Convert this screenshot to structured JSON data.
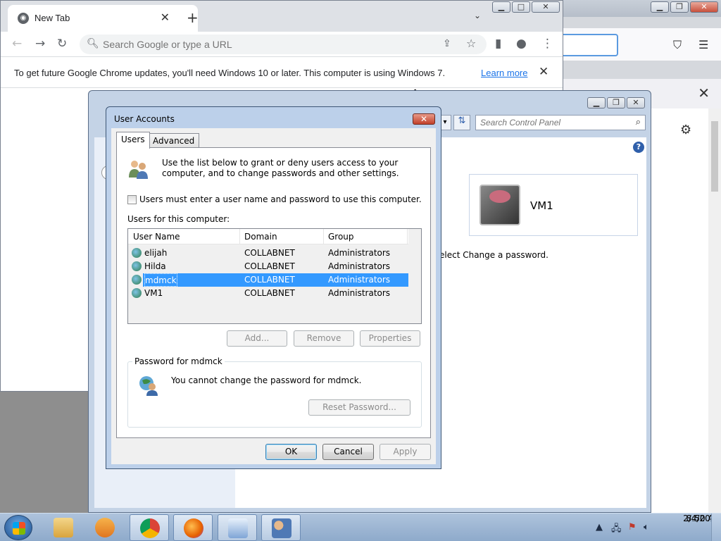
{
  "chrome": {
    "tab_title": "New Tab",
    "omnibox_placeholder": "Search Google or type a URL",
    "infobar_message": "To get future Google Chrome updates, you'll need Windows 10 or later. This computer is using Windows 7.",
    "infobar_link": "Learn more"
  },
  "control_panel": {
    "search_placeholder": "Search Control Panel",
    "user_name": "VM1",
    "hint_text": "elect Change a password."
  },
  "dialog": {
    "title": "User Accounts",
    "tabs": [
      "Users",
      "Advanced"
    ],
    "intro": "Use the list below to grant or deny users access to your computer, and to change passwords and other settings.",
    "checkbox_label": "Users must enter a user name and password to use this computer.",
    "checkbox_checked": false,
    "users_label": "Users for this computer:",
    "columns": [
      "User Name",
      "Domain",
      "Group"
    ],
    "rows": [
      {
        "name": "elijah",
        "domain": "COLLABNET",
        "group": "Administrators"
      },
      {
        "name": "Hilda",
        "domain": "COLLABNET",
        "group": "Administrators"
      },
      {
        "name": "mdmck",
        "domain": "COLLABNET",
        "group": "Administrators"
      },
      {
        "name": "VM1",
        "domain": "COLLABNET",
        "group": "Administrators"
      }
    ],
    "selected_row": 2,
    "buttons": {
      "add": "Add...",
      "remove": "Remove",
      "properties": "Properties"
    },
    "password_group_label": "Password for mdmck",
    "password_message": "You cannot change the password for mdmck.",
    "reset_password": "Reset Password...",
    "ok": "OK",
    "cancel": "Cancel",
    "apply": "Apply"
  },
  "taskbar": {
    "time": "8:50 AM",
    "date": "2/4/2023"
  }
}
